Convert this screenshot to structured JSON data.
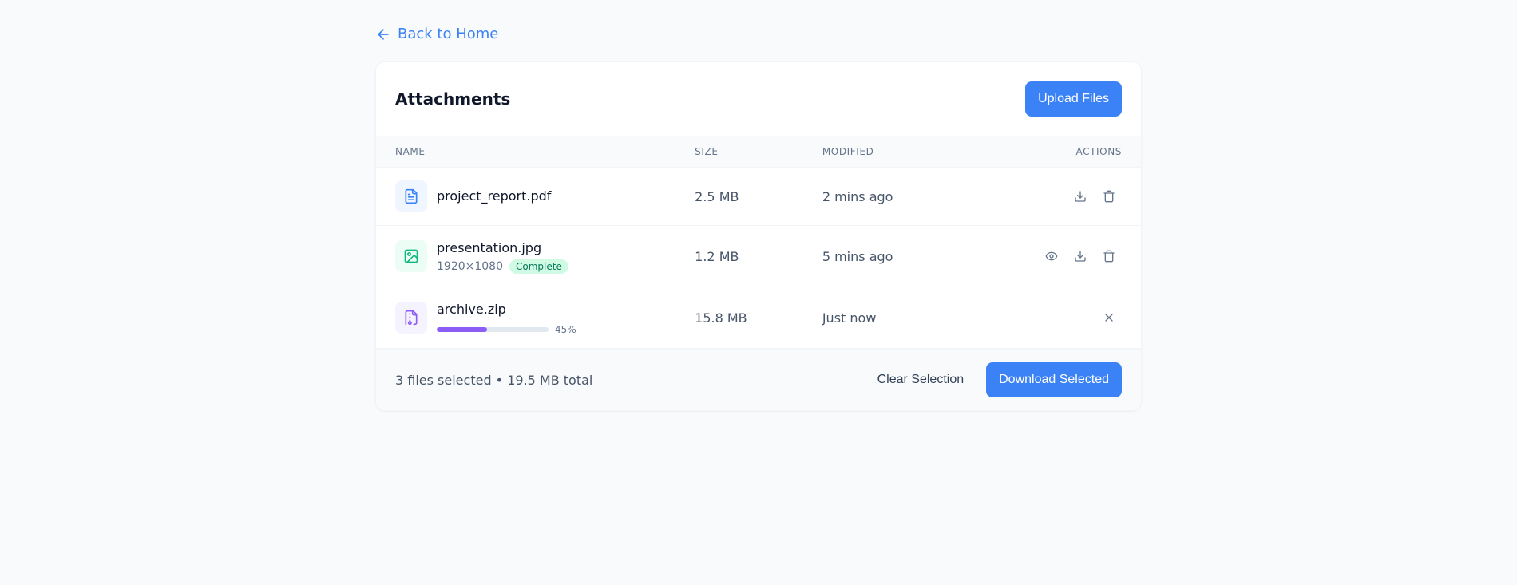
{
  "nav": {
    "back_label": "Back to Home"
  },
  "header": {
    "title": "Attachments",
    "upload_label": "Upload Files"
  },
  "columns": {
    "name": "Name",
    "size": "Size",
    "modified": "Modified",
    "actions": "Actions"
  },
  "files": [
    {
      "name": "project_report.pdf",
      "size": "2.5 MB",
      "modified": "2 mins ago",
      "type": "pdf"
    },
    {
      "name": "presentation.jpg",
      "size": "1.2 MB",
      "modified": "5 mins ago",
      "type": "img",
      "dimensions": "1920×1080",
      "status": "Complete"
    },
    {
      "name": "archive.zip",
      "size": "15.8 MB",
      "modified": "Just now",
      "type": "zip",
      "progress": 45,
      "progress_text": "45%"
    }
  ],
  "footer": {
    "summary": "3 files selected • 19.5 MB total",
    "clear_label": "Clear Selection",
    "download_label": "Download Selected"
  }
}
